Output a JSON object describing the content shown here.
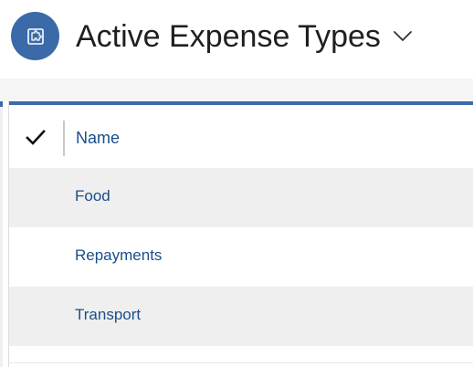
{
  "header": {
    "title": "Active Expense Types",
    "entity_icon": "puzzle-entity-icon",
    "view_selector_icon": "chevron-down-icon"
  },
  "grid": {
    "select_all_icon": "checkmark-icon",
    "columns": [
      {
        "label": "Name"
      }
    ],
    "rows": [
      {
        "name": "Food"
      },
      {
        "name": "Repayments"
      },
      {
        "name": "Transport"
      }
    ]
  },
  "colors": {
    "accent": "#3b6aa8",
    "link": "#1a4e8a",
    "row_alt": "#efefef"
  }
}
